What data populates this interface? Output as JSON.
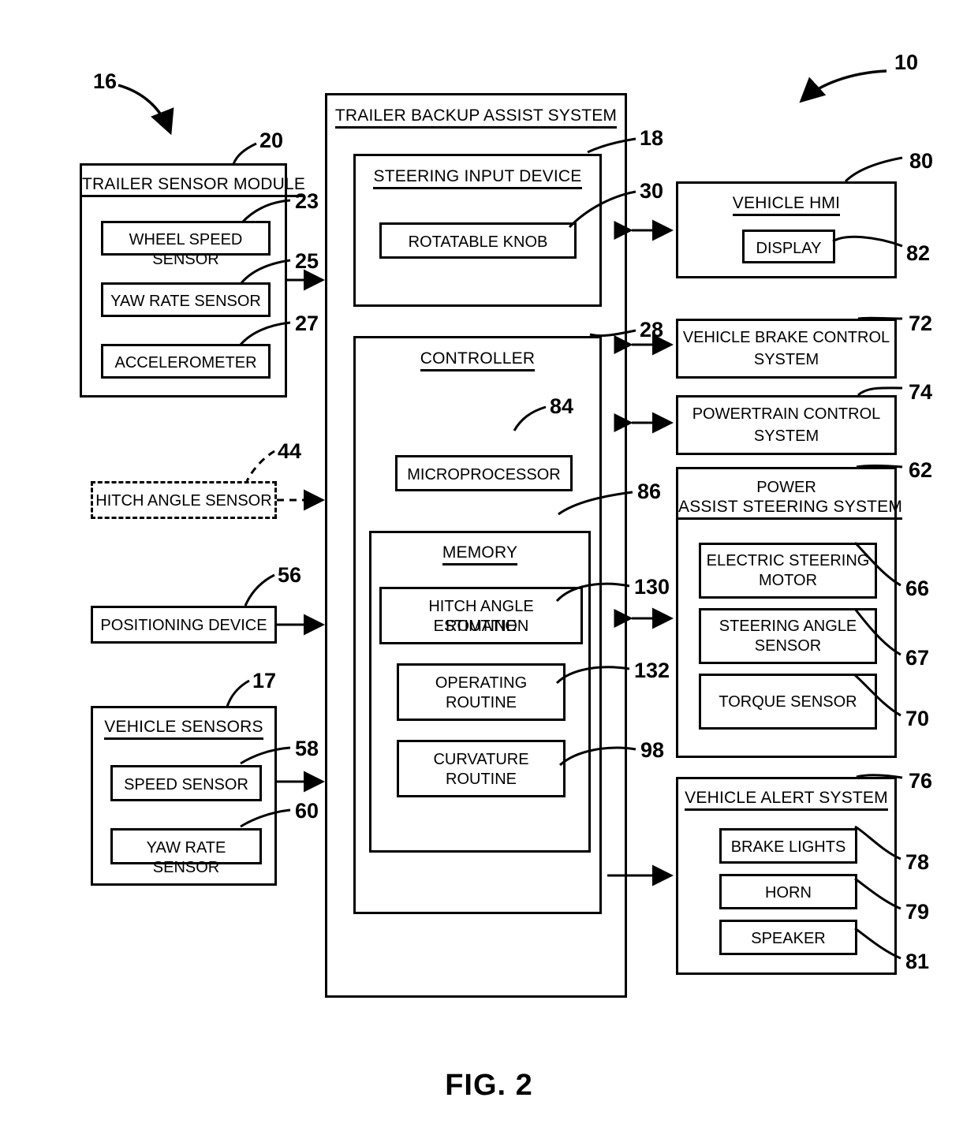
{
  "figure": {
    "caption": "FIG. 2",
    "system_ref": "10"
  },
  "trailer_sensor_module": {
    "title": "TRAILER SENSOR MODULE",
    "ref": "20",
    "group_ref": "16",
    "items": [
      {
        "label": "WHEEL SPEED SENSOR",
        "ref": "23"
      },
      {
        "label": "YAW RATE SENSOR",
        "ref": "25"
      },
      {
        "label": "ACCELEROMETER",
        "ref": "27"
      }
    ]
  },
  "hitch_angle_sensor": {
    "label": "HITCH ANGLE SENSOR",
    "ref": "44"
  },
  "positioning_device": {
    "label": "POSITIONING DEVICE",
    "ref": "56"
  },
  "vehicle_sensors": {
    "title": "VEHICLE SENSORS",
    "ref": "17",
    "items": [
      {
        "label": "SPEED SENSOR",
        "ref": "58"
      },
      {
        "label": "YAW RATE SENSOR",
        "ref": "60"
      }
    ]
  },
  "trailer_backup_assist_system": {
    "title": "TRAILER BACKUP ASSIST SYSTEM",
    "steering_input_device": {
      "title": "STEERING INPUT DEVICE",
      "ref": "18",
      "knob": {
        "label": "ROTATABLE KNOB",
        "ref": "30"
      }
    },
    "controller": {
      "title": "CONTROLLER",
      "ref": "28",
      "microprocessor": {
        "label": "MICROPROCESSOR",
        "ref": "84"
      },
      "memory": {
        "title": "MEMORY",
        "ref": "86",
        "routines": [
          {
            "line1": "HITCH ANGLE ESTIMATION",
            "line2": "ROUTINE",
            "ref": "130"
          },
          {
            "line1": "OPERATING",
            "line2": "ROUTINE",
            "ref": "132"
          },
          {
            "line1": "CURVATURE",
            "line2": "ROUTINE",
            "ref": "98"
          }
        ]
      }
    }
  },
  "vehicle_hmi": {
    "title": "VEHICLE HMI",
    "ref": "80",
    "display": {
      "label": "DISPLAY",
      "ref": "82"
    }
  },
  "vehicle_brake_control_system": {
    "line1": "VEHICLE BRAKE CONTROL",
    "line2": "SYSTEM",
    "ref": "72"
  },
  "powertrain_control_system": {
    "line1": "POWERTRAIN CONTROL",
    "line2": "SYSTEM",
    "ref": "74"
  },
  "power_assist_steering_system": {
    "title_line1": "POWER",
    "title_line2": "ASSIST STEERING SYSTEM",
    "ref": "62",
    "items": [
      {
        "line1": "ELECTRIC STEERING",
        "line2": "MOTOR",
        "ref": "66"
      },
      {
        "line1": "STEERING ANGLE",
        "line2": "SENSOR",
        "ref": "67"
      },
      {
        "line1": "TORQUE SENSOR",
        "line2": "",
        "ref": "70"
      }
    ]
  },
  "vehicle_alert_system": {
    "title": "VEHICLE ALERT SYSTEM",
    "ref": "76",
    "items": [
      {
        "label": "BRAKE LIGHTS",
        "ref": "78"
      },
      {
        "label": "HORN",
        "ref": "79"
      },
      {
        "label": "SPEAKER",
        "ref": "81"
      }
    ]
  }
}
